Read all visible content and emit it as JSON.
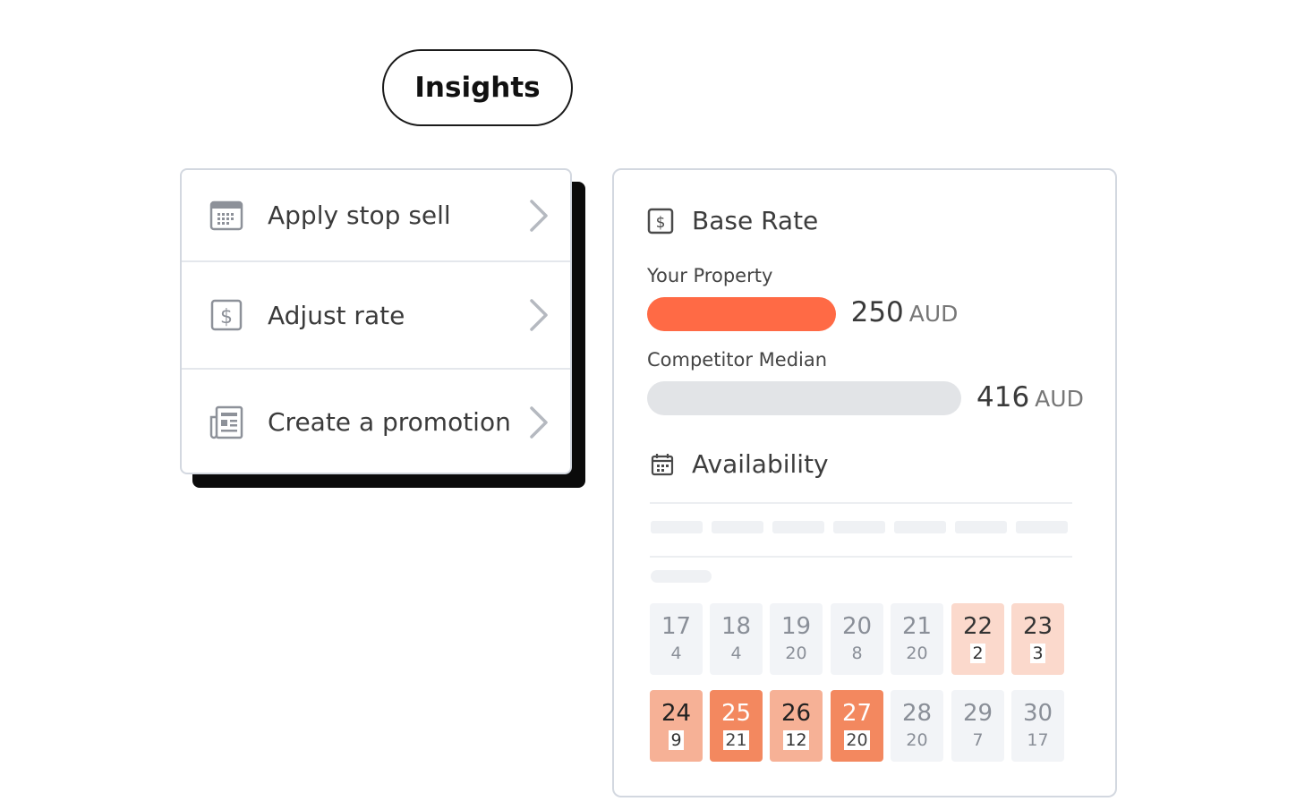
{
  "header": {
    "pill_label": "Insights"
  },
  "actions": [
    {
      "label": "Apply stop sell",
      "icon": "calendar-grid-icon"
    },
    {
      "label": "Adjust rate",
      "icon": "dollar-icon"
    },
    {
      "label": "Create a promotion",
      "icon": "newspaper-icon"
    }
  ],
  "base_rate": {
    "title": "Base Rate",
    "your_property": {
      "label": "Your Property",
      "value": "250",
      "currency": "AUD",
      "fraction": 0.6
    },
    "competitor": {
      "label": "Competitor Median",
      "value": "416",
      "currency": "AUD",
      "fraction": 1.0
    }
  },
  "availability": {
    "title": "Availability",
    "days": [
      {
        "day": "17",
        "count": "4",
        "level": 0
      },
      {
        "day": "18",
        "count": "4",
        "level": 0
      },
      {
        "day": "19",
        "count": "20",
        "level": 0
      },
      {
        "day": "20",
        "count": "8",
        "level": 0
      },
      {
        "day": "21",
        "count": "20",
        "level": 0
      },
      {
        "day": "22",
        "count": "2",
        "level": 1
      },
      {
        "day": "23",
        "count": "3",
        "level": 1
      },
      {
        "day": "24",
        "count": "9",
        "level": 2
      },
      {
        "day": "25",
        "count": "21",
        "level": 3
      },
      {
        "day": "26",
        "count": "12",
        "level": 2
      },
      {
        "day": "27",
        "count": "20",
        "level": 3
      },
      {
        "day": "28",
        "count": "20",
        "level": 0
      },
      {
        "day": "29",
        "count": "7",
        "level": 0
      },
      {
        "day": "30",
        "count": "17",
        "level": 0
      }
    ]
  },
  "colors": {
    "accent": "#ff6a45",
    "bar_gray": "#e2e4e7",
    "card_border": "#d3d8e0"
  }
}
